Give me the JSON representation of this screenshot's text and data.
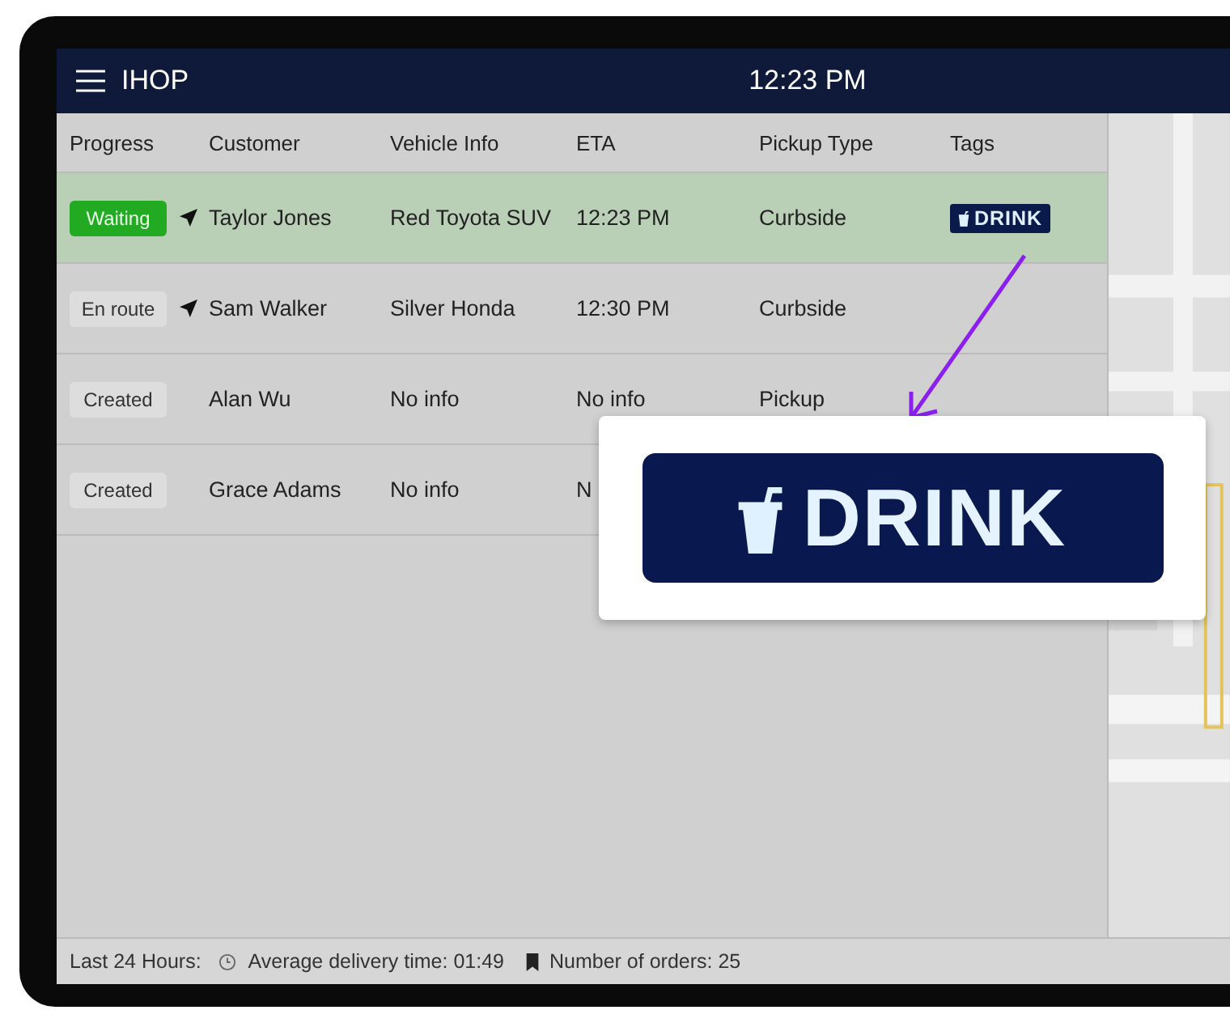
{
  "header": {
    "app_name": "IHOP",
    "time": "12:23 PM"
  },
  "table": {
    "columns": [
      "Progress",
      "Customer",
      "Vehicle Info",
      "ETA",
      "Pickup Type",
      "Tags"
    ],
    "rows": [
      {
        "progress": "Waiting",
        "color": "#22aa22",
        "navigating": true,
        "selected": true,
        "customer": "Taylor Jones",
        "vehicle": "Red Toyota SUV",
        "eta": "12:23 PM",
        "pickup_type": "Curbside",
        "tags": [
          "DRINK"
        ]
      },
      {
        "progress": "En route",
        "color": "#dddddd",
        "navigating": true,
        "selected": false,
        "customer": "Sam Walker",
        "vehicle": "Silver Honda",
        "eta": "12:30 PM",
        "pickup_type": "Curbside",
        "tags": []
      },
      {
        "progress": "Created",
        "color": "#dddddd",
        "navigating": false,
        "selected": false,
        "customer": "Alan Wu",
        "vehicle": "No info",
        "eta": "No info",
        "pickup_type": "Pickup",
        "tags": []
      },
      {
        "progress": "Created",
        "color": "#dddddd",
        "navigating": false,
        "selected": false,
        "customer": "Grace Adams",
        "vehicle": "No info",
        "eta": "N",
        "tags": []
      }
    ]
  },
  "callout": {
    "tag": "DRINK"
  },
  "status_bar": {
    "label": "Last 24 Hours:",
    "average": "Average delivery time: 01:49",
    "orders": "Number of orders: 25"
  }
}
